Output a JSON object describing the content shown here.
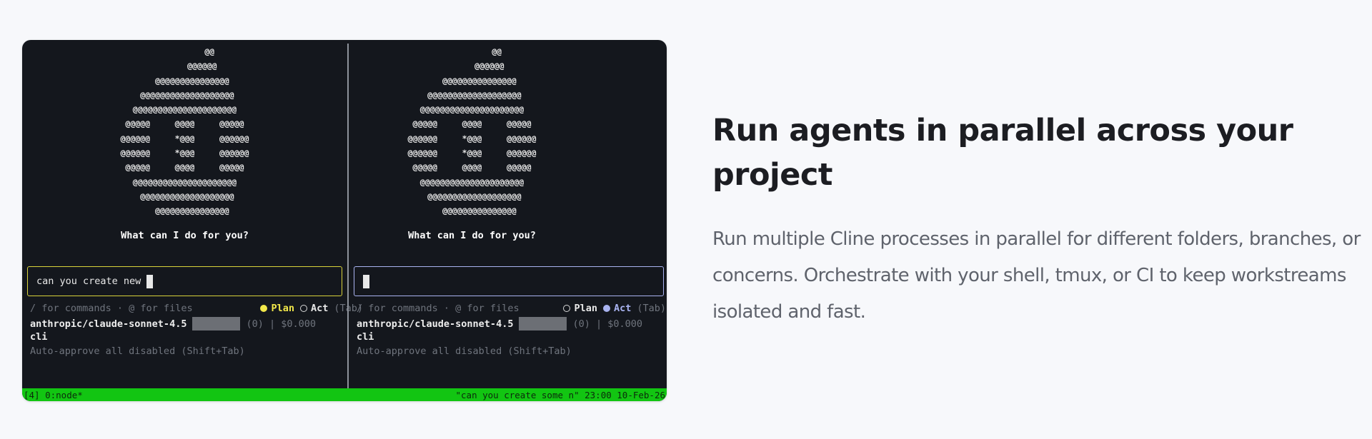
{
  "logo_art": "          @@\n       @@@@@@\n   @@@@@@@@@@@@@@@\n @@@@@@@@@@@@@@@@@@@\n@@@@@@@@@@@@@@@@@@@@@\n@@@@@     @@@@     @@@@@\n@@@@@@     *@@@     @@@@@@\n@@@@@@     *@@@     @@@@@@\n@@@@@     @@@@     @@@@@\n@@@@@@@@@@@@@@@@@@@@@\n @@@@@@@@@@@@@@@@@@@\n   @@@@@@@@@@@@@@@",
  "panes": [
    {
      "greeting": "What can I do for you?",
      "input_value": "can you create new",
      "hint": "/ for commands · @ for files",
      "mode_plan": "Plan",
      "mode_act": "Act",
      "active_mode": "plan",
      "tab_hint": "(Tab)",
      "model": "anthropic/claude-sonnet-4.5",
      "token_count": "(0)",
      "cost": "| $0.000",
      "cli": "cli",
      "auto_approve": "Auto-approve all disabled (Shift+Tab)"
    },
    {
      "greeting": "What can I do for you?",
      "input_value": "",
      "hint": "/ for commands · @ for files",
      "mode_plan": "Plan",
      "mode_act": "Act",
      "active_mode": "act",
      "tab_hint": "(Tab)",
      "model": "anthropic/claude-sonnet-4.5",
      "token_count": "(0)",
      "cost": "| $0.000",
      "cli": "cli",
      "auto_approve": "Auto-approve all disabled (Shift+Tab)"
    }
  ],
  "status_bar": {
    "left": "[4] 0:node*",
    "right": "\"can you create some n\" 23:00 10-Feb-26"
  },
  "heading": "Run agents in parallel across your project",
  "description": "Run multiple Cline processes in parallel for different folders, branches, or concerns. Orchestrate with your shell, tmux, or CI to keep workstreams isolated and fast.",
  "colors": {
    "terminal_bg": "#14171d",
    "plan_accent": "#f2e84a",
    "act_accent": "#a9b3f0",
    "status_bar": "#12c512",
    "page_bg": "#f7f8fb"
  }
}
